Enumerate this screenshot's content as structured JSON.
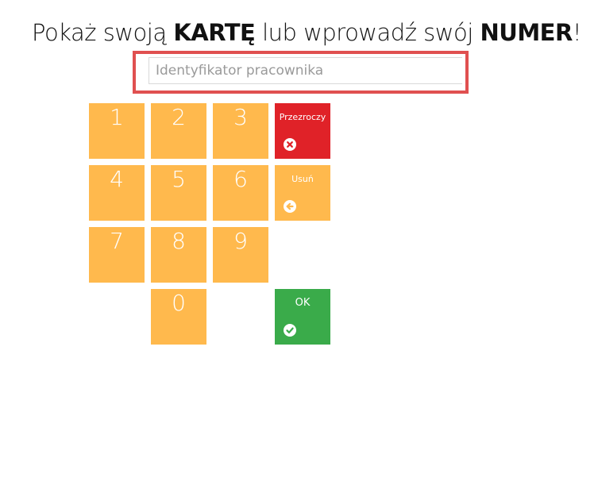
{
  "header": {
    "text_before": "Pokaż swoją ",
    "bold_card": "KARTĘ",
    "text_middle": " lub wprowadź swój ",
    "bold_number": "NUMER",
    "text_end": "!"
  },
  "employee_input": {
    "value": "",
    "placeholder": "Identyfikator pracownika"
  },
  "keypad": {
    "keys": [
      "1",
      "2",
      "3",
      "4",
      "5",
      "6",
      "7",
      "8",
      "9",
      "0"
    ]
  },
  "actions": {
    "clear": {
      "label": "Przezroczy",
      "icon": "times-circle-icon",
      "color": "#e02228"
    },
    "delete": {
      "label": "Usuń",
      "icon": "arrow-left-circle-icon",
      "color": "#ffb94d"
    },
    "ok": {
      "label": "OK",
      "icon": "check-circle-icon",
      "color": "#3aab4a"
    }
  },
  "colors": {
    "keypad": "#ffb94d",
    "input_highlight": "#e05050"
  }
}
